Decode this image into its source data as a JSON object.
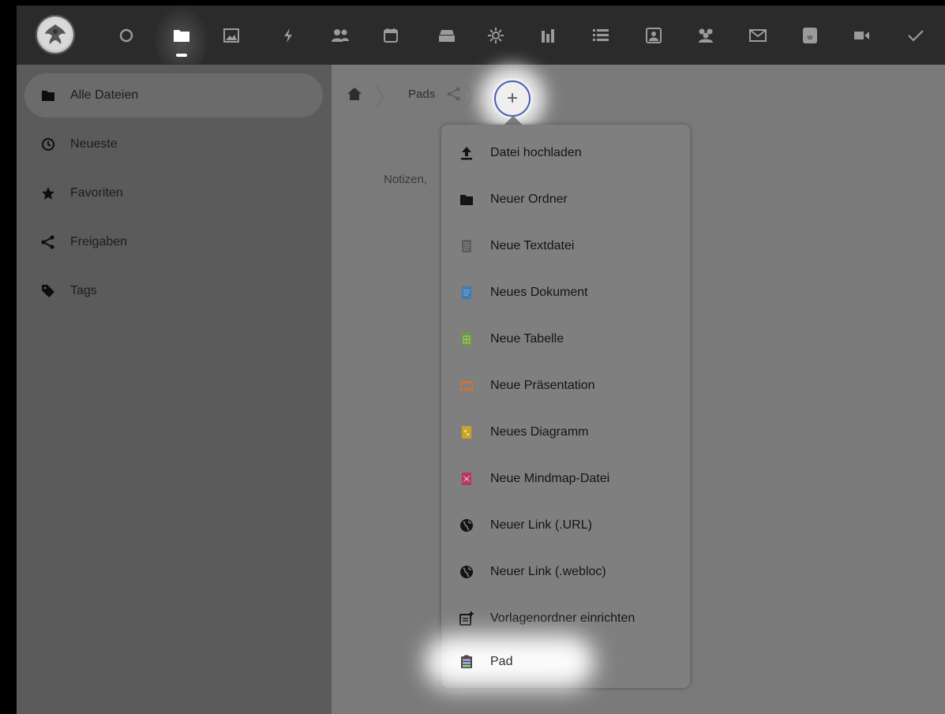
{
  "topbar": {
    "apps": [
      {
        "name": "dashboard-icon"
      },
      {
        "name": "files-icon",
        "active": true
      },
      {
        "name": "photos-icon"
      },
      {
        "name": "activity-icon"
      },
      {
        "name": "contacts-icon"
      },
      {
        "name": "calendar-icon"
      },
      {
        "name": "deck-icon"
      },
      {
        "name": "sun-icon"
      },
      {
        "name": "analytics-icon"
      },
      {
        "name": "list-icon"
      },
      {
        "name": "portrait-icon"
      },
      {
        "name": "circles-icon"
      },
      {
        "name": "mail-icon"
      },
      {
        "name": "document-icon"
      },
      {
        "name": "video-icon"
      },
      {
        "name": "tasks-check-icon"
      }
    ]
  },
  "sidebar": {
    "items": [
      {
        "label": "Alle Dateien",
        "icon": "folder-icon",
        "active": true
      },
      {
        "label": "Neueste",
        "icon": "clock-icon"
      },
      {
        "label": "Favoriten",
        "icon": "star-icon"
      },
      {
        "label": "Freigaben",
        "icon": "share-icon"
      },
      {
        "label": "Tags",
        "icon": "tag-icon"
      }
    ]
  },
  "breadcrumb": {
    "folder": "Pads",
    "new_button": "+"
  },
  "main": {
    "empty_text": "Notizen,"
  },
  "menu": {
    "items": [
      {
        "label": "Datei hochladen",
        "icon": "upload-icon",
        "color": "#141414"
      },
      {
        "label": "Neuer Ordner",
        "icon": "folder-icon",
        "color": "#141414"
      },
      {
        "label": "Neue Textdatei",
        "icon": "text-file-icon",
        "color": "#5e5e5e"
      },
      {
        "label": "Neues Dokument",
        "icon": "document-file-icon",
        "color": "#3d7eb8"
      },
      {
        "label": "Neue Tabelle",
        "icon": "spreadsheet-file-icon",
        "color": "#6a9a3a"
      },
      {
        "label": "Neue Präsentation",
        "icon": "presentation-file-icon",
        "color": "#c8743a"
      },
      {
        "label": "Neues Diagramm",
        "icon": "diagram-file-icon",
        "color": "#c9a428"
      },
      {
        "label": "Neue Mindmap-Datei",
        "icon": "mindmap-file-icon",
        "color": "#b53a5a"
      },
      {
        "label": "Neuer Link (.URL)",
        "icon": "globe-icon",
        "color": "#141414"
      },
      {
        "label": "Neuer Link (.webloc)",
        "icon": "globe-icon",
        "color": "#141414"
      },
      {
        "label": "Vorlagenordner einrichten",
        "icon": "template-icon",
        "color": "#141414"
      },
      {
        "label": "Pad",
        "icon": "pad-icon",
        "color": "#3c3c3c"
      }
    ]
  }
}
